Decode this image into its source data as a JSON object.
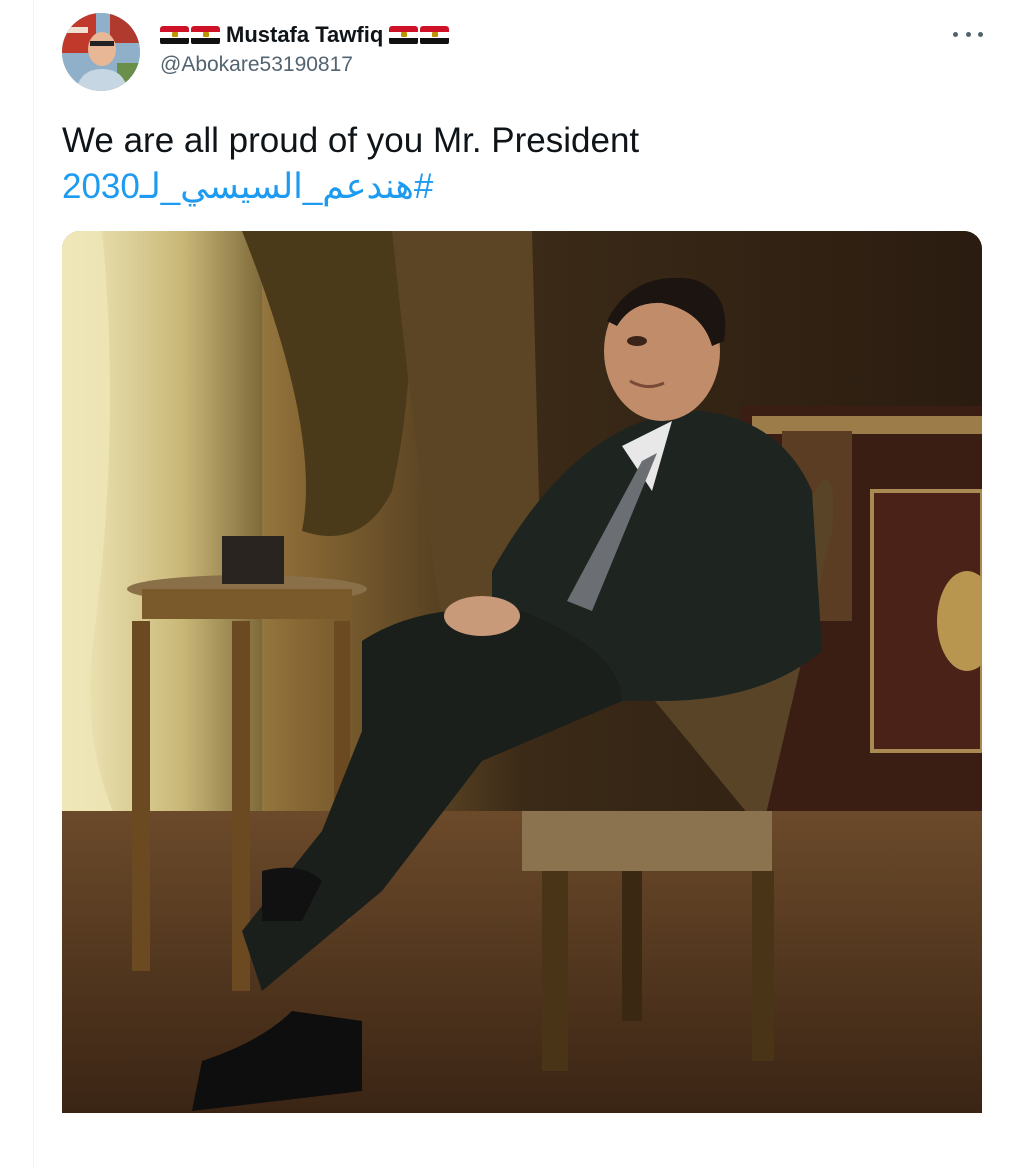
{
  "tweet": {
    "author": {
      "display_name": "Mustafa Tawfiq",
      "handle": "@Abokare53190817",
      "name_prefix_flags": [
        "egypt-flag-icon",
        "egypt-flag-icon"
      ],
      "name_suffix_flags": [
        "egypt-flag-icon",
        "egypt-flag-icon"
      ]
    },
    "text": "We are all proud of you Mr. President",
    "hashtag": "#هندعم_السيسي_لـ2030",
    "more_menu_icon": "ellipsis-icon",
    "media_description_icon": "photo"
  },
  "colors": {
    "text": "#0f1419",
    "secondary": "#536471",
    "link": "#1d9bf0"
  }
}
